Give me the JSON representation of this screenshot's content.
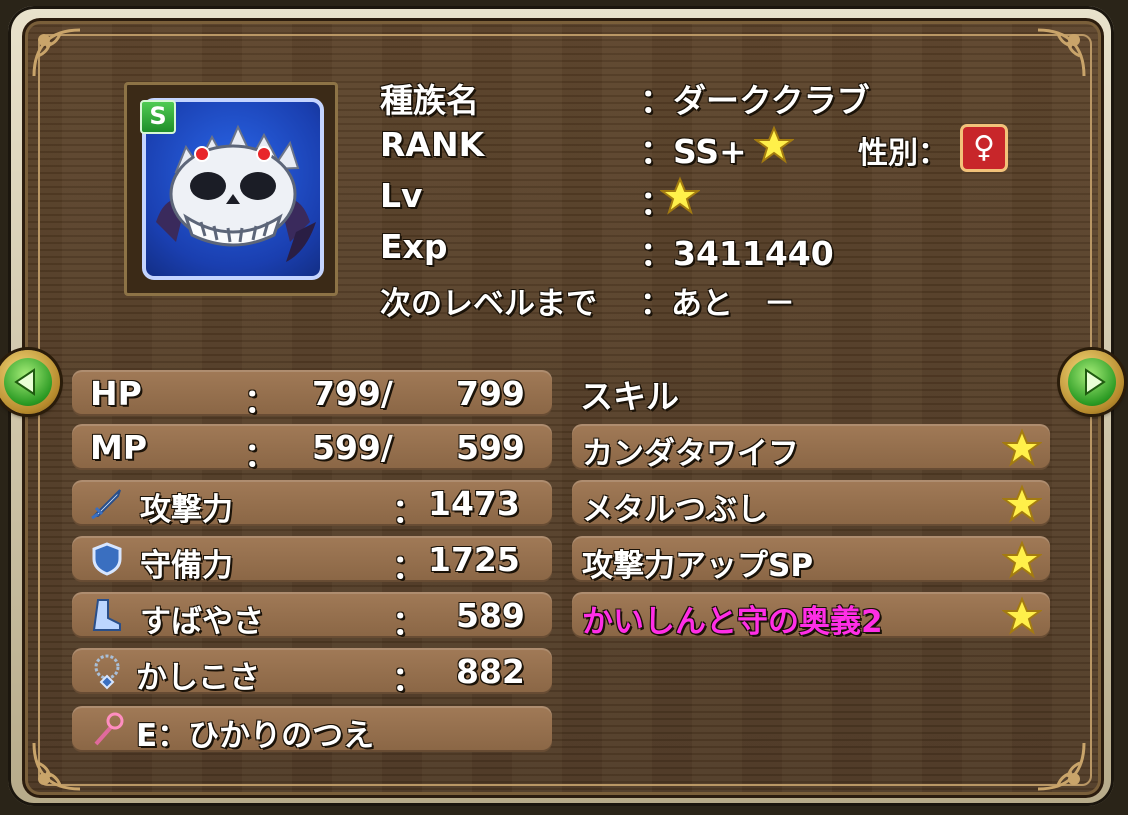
{
  "profile": {
    "labels": {
      "species": "種族名",
      "rank": "RANK",
      "lv": "Lv",
      "exp": "Exp",
      "next_level": "次のレベルまで"
    },
    "values": {
      "species": "：ダーククラブ",
      "rank": "：SS+",
      "lv": "：",
      "exp": "：3411440",
      "next_level": "：あと　－"
    },
    "gender_label": "性別：",
    "gender_symbol": "♀",
    "rank_badge": "S"
  },
  "stats": {
    "hp": {
      "label": "HP",
      "colon": "：",
      "current": "799/",
      "max": "799"
    },
    "mp": {
      "label": "MP",
      "colon": "：",
      "current": "599/",
      "max": "599"
    },
    "attack": {
      "label": "攻撃力",
      "colon": "：",
      "value": "1473",
      "icon": "sword-icon"
    },
    "defense": {
      "label": "守備力",
      "colon": "：",
      "value": "1725",
      "icon": "shield-icon"
    },
    "speed": {
      "label": "すばやさ",
      "colon": "：",
      "value": "589",
      "icon": "boot-icon"
    },
    "wisdom": {
      "label": "かしこさ",
      "colon": "：",
      "value": "882",
      "icon": "necklace-icon"
    },
    "equipment": {
      "label": "E：ひかりのつえ",
      "icon": "staff-icon"
    }
  },
  "skills": {
    "title": "スキル",
    "items": [
      {
        "name": "カンダタワイフ",
        "color": "#ffffff"
      },
      {
        "name": "メタルつぶし",
        "color": "#ffffff"
      },
      {
        "name": "攻撃力アップSP",
        "color": "#ffffff"
      },
      {
        "name": "かいしんと守の奥義2",
        "color": "#ff2ee6"
      }
    ]
  },
  "colors": {
    "bar": "#9a7350",
    "gender_badge": "#c8262a",
    "arrow_green": "#2c9b24",
    "star": "#fff04a"
  }
}
